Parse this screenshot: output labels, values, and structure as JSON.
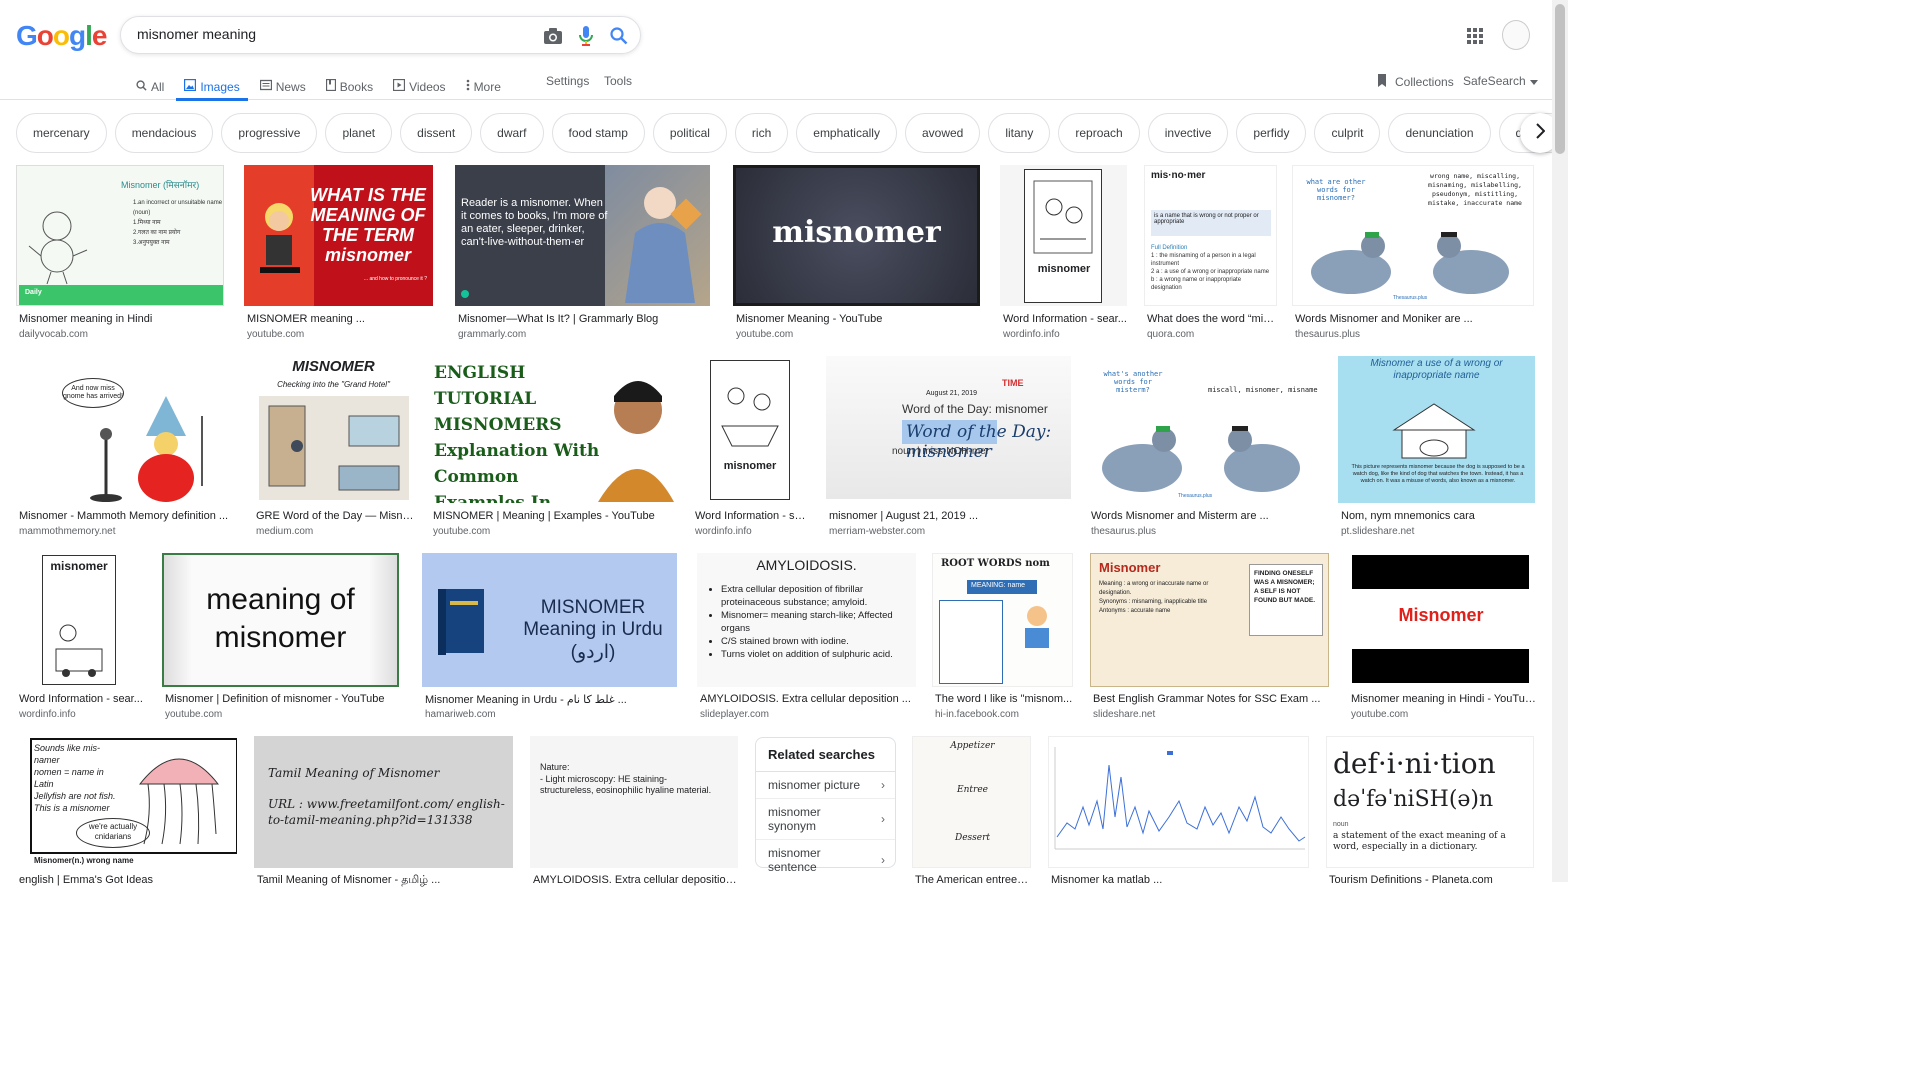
{
  "query": "misnomer meaning",
  "logo_letters": [
    "G",
    "o",
    "o",
    "g",
    "l",
    "e"
  ],
  "colors": {
    "blue": "#4285F4",
    "red": "#EA4335",
    "yellow": "#FBBC05",
    "green": "#34A853",
    "accent": "#1a73e8"
  },
  "tabs": [
    {
      "label": "All",
      "icon": "search-icon"
    },
    {
      "label": "Images",
      "icon": "image-icon",
      "active": true
    },
    {
      "label": "News",
      "icon": "news-icon"
    },
    {
      "label": "Books",
      "icon": "book-icon"
    },
    {
      "label": "Videos",
      "icon": "video-icon"
    },
    {
      "label": "More",
      "icon": "more-icon"
    }
  ],
  "tools": {
    "settings": "Settings",
    "tools": "Tools",
    "collections": "Collections",
    "safesearch": "SafeSearch"
  },
  "chips": [
    "mercenary",
    "mendacious",
    "progressive",
    "planet",
    "dissent",
    "dwarf",
    "food stamp",
    "political",
    "rich",
    "emphatically",
    "avowed",
    "litany",
    "reproach",
    "invective",
    "perfidy",
    "culprit",
    "denunciation",
    "dispatch"
  ],
  "results": [
    {
      "caption": "Misnomer meaning in Hindi",
      "source": "dailyvocab.com",
      "thumb_text": "Misnomer (मिसनॉमर)"
    },
    {
      "caption": "MISNOMER meaning ...",
      "source": "youtube.com",
      "thumb_text": "WHAT IS THE MEANING OF THE TERM misnomer"
    },
    {
      "caption": "Misnomer—What Is It? | Grammarly Blog",
      "source": "grammarly.com",
      "thumb_text": "Reader is a misnomer. When it comes to books, I'm more of an eater, sleeper, drinker, can't-live-without-them-er"
    },
    {
      "caption": "Misnomer Meaning - YouTube",
      "source": "youtube.com",
      "thumb_text": "misnomer"
    },
    {
      "caption": "Word Information - sear...",
      "source": "wordinfo.info",
      "thumb_text": "misnomer"
    },
    {
      "caption": "What does the word “mis...",
      "source": "quora.com",
      "thumb_text": "mis·no·mer"
    },
    {
      "caption": "Words Misnomer and Moniker are ...",
      "source": "thesaurus.plus",
      "thumb_text": "what are other words for misnomer?"
    },
    {
      "caption": "Misnomer - Mammoth Memory definition ...",
      "source": "mammothmemory.net",
      "thumb_text": "And now miss gnome has arrived!"
    },
    {
      "caption": "GRE Word of the Day — Misno...",
      "source": "medium.com",
      "thumb_text": "MISNOMER"
    },
    {
      "caption": "MISNOMER | Meaning | Examples - YouTube",
      "source": "youtube.com",
      "thumb_text": "ENGLISH TUTORIAL MISNOMERS Explanation With Common Examples In Hindi"
    },
    {
      "caption": "Word Information - se...",
      "source": "wordinfo.info",
      "thumb_text": "misnomer"
    },
    {
      "caption": "misnomer | August 21, 2019 ...",
      "source": "merriam-webster.com",
      "thumb_text": "Word of the Day: misnomer"
    },
    {
      "caption": "Words Misnomer and Misterm are ...",
      "source": "thesaurus.plus",
      "thumb_text": "what's another words for misterm?"
    },
    {
      "caption": "Nom, nym mnemonics cara",
      "source": "pt.slideshare.net",
      "thumb_text": "Misnomer a use of a wrong or inappropriate name"
    },
    {
      "caption": "Word Information - sear...",
      "source": "wordinfo.info",
      "thumb_text": "misnomer"
    },
    {
      "caption": "Misnomer | Definition of misnomer - YouTube",
      "source": "youtube.com",
      "thumb_text": "meaning of misnomer"
    },
    {
      "caption": "Misnomer Meaning in Urdu - غلط کا نام ...",
      "source": "hamariweb.com",
      "thumb_text": "MISNOMER Meaning in Urdu (اردو)"
    },
    {
      "caption": "AMYLOIDOSIS. Extra cellular deposition ...",
      "source": "slideplayer.com",
      "thumb_text": "AMYLOIDOSIS."
    },
    {
      "caption": "The word I like is \"misnom...",
      "source": "hi-in.facebook.com",
      "thumb_text": "ROOT WORDS nom"
    },
    {
      "caption": "Best English Grammar Notes for SSC Exam ...",
      "source": "slideshare.net",
      "thumb_text": "Misnomer"
    },
    {
      "caption": "Misnomer meaning in Hindi - YouTube",
      "source": "youtube.com",
      "thumb_text": "Misnomer"
    },
    {
      "caption": "english | Emma's Got Ideas",
      "source": "",
      "thumb_text": "Sounds like mis- namer"
    },
    {
      "caption": "Tamil Meaning of Misnomer - தமிழ் ...",
      "source": "",
      "thumb_text": "Tamil Meaning of Misnomer"
    },
    {
      "caption": "AMYLOIDOSIS. Extra cellular deposition ...",
      "source": "",
      "thumb_text": "Nature:"
    },
    {
      "caption": "The American entree: ...",
      "source": "",
      "thumb_text": "Appetizer"
    },
    {
      "caption": "Misnomer ka matlab ...",
      "source": "",
      "thumb_text": ""
    },
    {
      "caption": "Tourism Definitions - Planeta.com",
      "source": "",
      "thumb_text": "def·i·ni·tion"
    }
  ],
  "related": {
    "title": "Related searches",
    "items": [
      "misnomer picture",
      "misnomer synonym",
      "misnomer sentence"
    ]
  },
  "thumb_details": {
    "hindi_lines": [
      "1.an incorrect or unsuitable name (noun)",
      "1.मिथ्या नाम",
      "2.गलत का नाम प्रयोग",
      "3.अनुपयुक्त नाम"
    ],
    "daily_bar": "Daily",
    "yt_sub": "... and how to pronounce it ?",
    "quora_lines": [
      "is a name that is wrong or not proper or appropriate",
      "Full Definition",
      "1 : the misnaming of a person in a legal instrument",
      "2 a : a use of a wrong or inappropriate name",
      "b : a wrong name or inappropriate designation"
    ],
    "pigeon_right": "wrong name, miscalling, misnaming, mislabelling, pseudonym, mistitling, mistake, inaccurate name",
    "pigeon2_right": "miscall, misnomer, misname",
    "thesaurus_brand": "Thesaurus.plus",
    "gre_sub": "Checking into the \"Grand Hotel\"",
    "mw_date": "August 21, 2019",
    "mw_time": "TIME",
    "mw_pron": "noun | miss-NOH-mer",
    "nom_caption": "This picture represents misnomer because the dog is supposed to be a watch dog, like the kind of dog that watches the town. Instead, it has a watch on. It was a misuse of words, also known as a misnomer.",
    "amy_lines": [
      "Extra cellular deposition of fibrillar proteinaceous substance; amyloid.",
      "Misnomer= meaning starch-like; Affected organs",
      "C/S stained brown with iodine.",
      "Turns violet on addition of sulphuric acid."
    ],
    "root_meaning": "MEANING: name",
    "ssc_lines": [
      "Meaning : a wrong or inaccurate name or designation.",
      "Synonyms : misnaming, inapplicable title",
      "Antonyms : accurate name"
    ],
    "ssc_quote": "FINDING ONESELF WAS A MISNOMER; A SELF IS NOT FOUND BUT MADE.",
    "jelly_lines": [
      "Sounds like mis- namer",
      "nomen = name in Latin",
      "Jellyfish are not fish. This is a misnomer",
      "we're actually cnidarians"
    ],
    "jelly_foot": "Misnomer(n.) wrong name",
    "tamil_url": "URL : www.freetamilfont.com/ english-to-tamil-meaning.php?id=131338",
    "amy2_lines": [
      "- Light microscopy: HE staining- structureless, eosinophilic hyaline material."
    ],
    "menu_lines": [
      "Entree",
      "Dessert"
    ],
    "def_pron": "dəˈfəˈniSH(ə)n",
    "def_noun": "noun",
    "def_text": "a statement of the exact meaning of a word, especially in a dictionary."
  }
}
